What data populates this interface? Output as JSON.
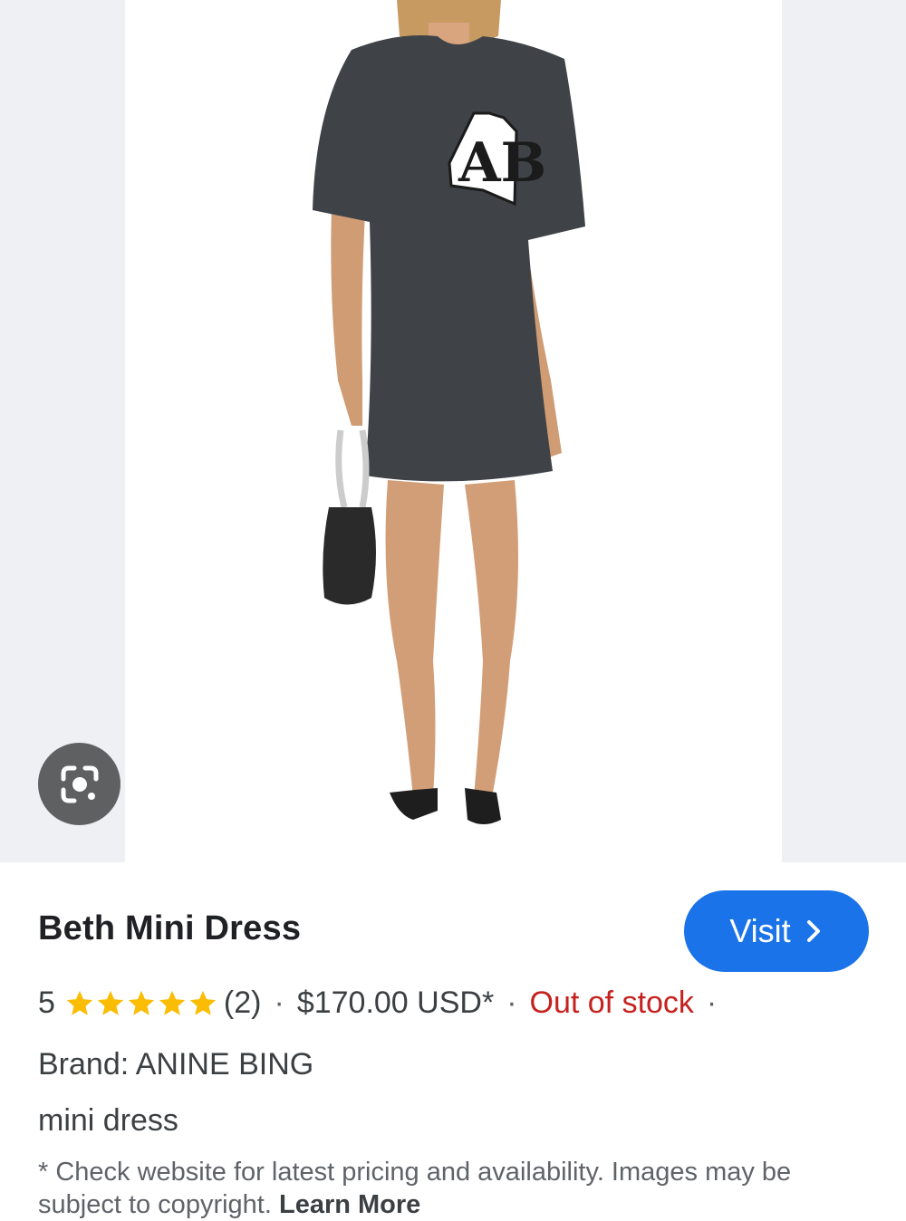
{
  "product": {
    "title": "Beth Mini Dress",
    "visit_label": "Visit",
    "rating_value": "5",
    "rating_stars": 5,
    "review_count": "(2)",
    "separator": "·",
    "price": "$170.00 USD*",
    "stock_status": "Out of stock",
    "brand_line": "Brand: ANINE BING",
    "category": "mini dress",
    "disclaimer": "* Check website for latest pricing and availability. Images may be subject to copyright.",
    "learn_more": "Learn More"
  },
  "image": {
    "patch_letters": "AB"
  },
  "colors": {
    "accent": "#1a73e8",
    "star": "#fbbc04",
    "out_of_stock": "#c5221f",
    "text_primary": "#202124",
    "text_secondary": "#3c4043",
    "image_side_bg": "#eef0f3",
    "lens_button": "#5f6061"
  },
  "icons": {
    "lens": "google-lens-icon",
    "chevron": "chevron-right-icon",
    "star": "star-icon"
  }
}
